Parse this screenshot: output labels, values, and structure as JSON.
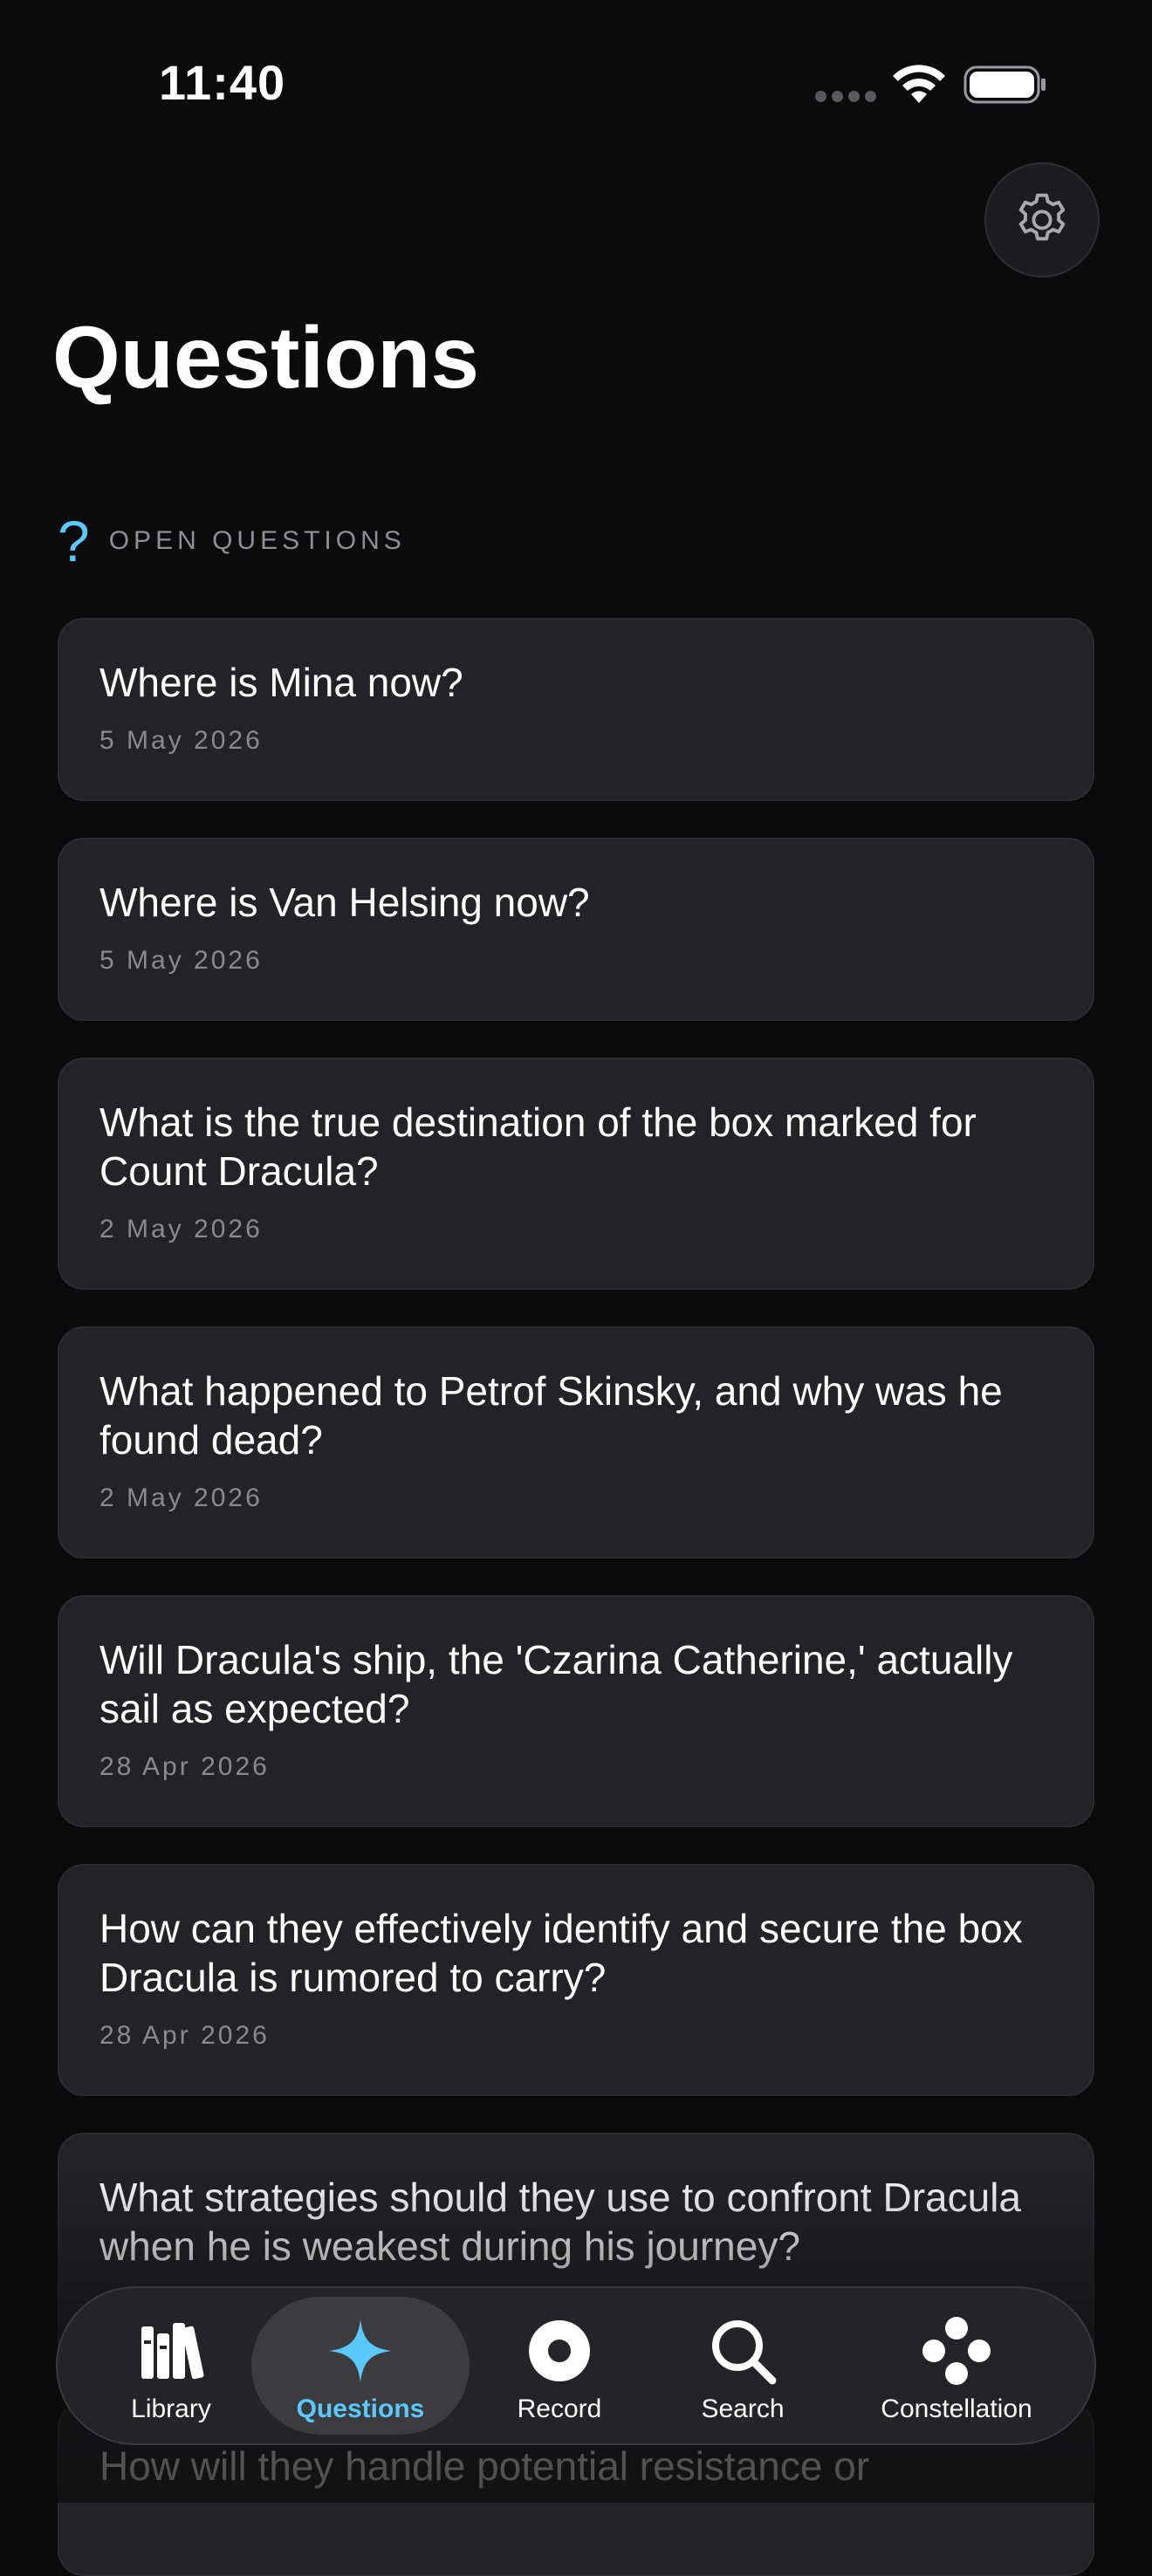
{
  "status_bar": {
    "time": "11:40"
  },
  "header": {
    "title": "Questions",
    "settings_icon": "gear-icon"
  },
  "section": {
    "icon": "?",
    "label": "OPEN QUESTIONS"
  },
  "questions": [
    {
      "text": "Where is Mina now?",
      "date": "5 May 2026"
    },
    {
      "text": "Where is Van Helsing now?",
      "date": "5 May 2026"
    },
    {
      "text": "What is the true destination of the box marked for Count Dracula?",
      "date": "2 May 2026"
    },
    {
      "text": "What happened to Petrof Skinsky, and why was he found dead?",
      "date": "2 May 2026"
    },
    {
      "text": "Will Dracula's ship, the 'Czarina Catherine,' actually sail as expected?",
      "date": "28 Apr 2026"
    },
    {
      "text": "How can they effectively identify and secure the box Dracula is rumored to carry?",
      "date": "28 Apr 2026"
    },
    {
      "text": "What strategies should they use to confront Dracula when he is weakest during his journey?",
      "date": ""
    },
    {
      "text": "How will they handle potential resistance or",
      "date": ""
    }
  ],
  "tab_bar": {
    "active": "Questions",
    "tabs": [
      {
        "label": "Library",
        "icon": "books-icon"
      },
      {
        "label": "Questions",
        "icon": "sparkle-icon"
      },
      {
        "label": "Record",
        "icon": "record-icon"
      },
      {
        "label": "Search",
        "icon": "search-icon"
      },
      {
        "label": "Constellation",
        "icon": "constellation-icon"
      }
    ]
  },
  "colors": {
    "background": "#0b0b0c",
    "card": "#232325",
    "accent": "#5ac8fa",
    "muted": "#8a8a8e"
  }
}
